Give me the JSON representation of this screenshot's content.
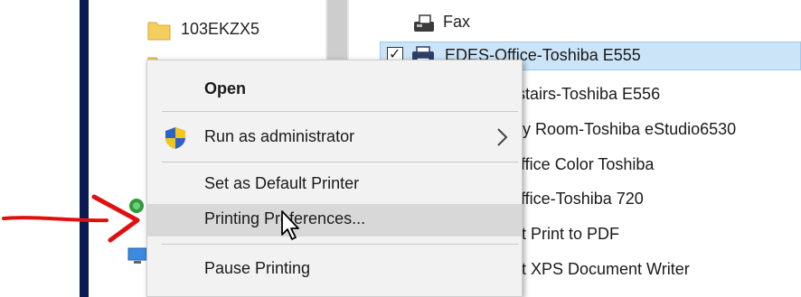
{
  "nav": {
    "folder_label": "103EKZX5"
  },
  "printers": {
    "fax": "Fax",
    "selected": "EDES-Office-Toshiba E555",
    "partial_items": [
      "stairs-Toshiba E556",
      "y Room-Toshiba eStudio6530",
      "ffice Color Toshiba",
      "ffice-Toshiba 720",
      "t Print to PDF",
      "t XPS Document Writer"
    ]
  },
  "context_menu": {
    "open": "Open",
    "run_as_admin": "Run as administrator",
    "set_default": "Set as Default Printer",
    "printing_preferences": "Printing Preferences...",
    "pause_printing": "Pause Printing"
  },
  "colors": {
    "selection": "#cce4f7",
    "hover": "#d8d8d8",
    "menu_bg": "#f2f2f2",
    "annotation_arrow": "#e01010"
  },
  "icons": {
    "folder": "folder-icon",
    "fax": "fax-icon",
    "printer": "printer-icon",
    "shield": "uac-shield-icon",
    "submenu": "chevron-right-icon",
    "cursor": "mouse-cursor-icon",
    "arrow": "red-annotation-arrow"
  }
}
